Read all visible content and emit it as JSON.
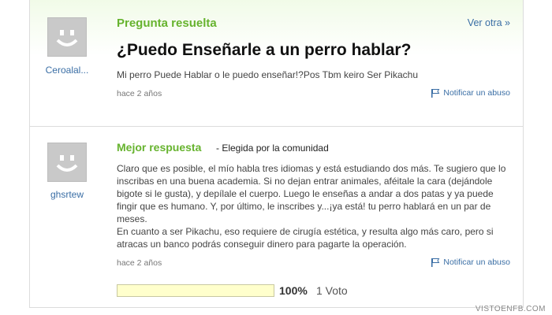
{
  "question": {
    "header": "Pregunta resuelta",
    "see_other": "Ver otra »",
    "asker": "Ceroalal...",
    "title": "¿Puedo Enseñarle a un perro hablar?",
    "detail": "Mi perro Puede Hablar o le puedo enseñar!?Pos Tbm keiro Ser Pikachu",
    "timestamp": "hace 2 años",
    "report": "Notificar un abuso"
  },
  "answer": {
    "header": "Mejor respuesta",
    "chosen_by": "- Elegida por la comunidad",
    "answerer": "ghsrtew",
    "paragraphs": [
      "Claro que es posible, el mío habla tres idiomas y está estudiando dos más. Te sugiero que lo inscribas en una buena academia. Si no dejan entrar animales, aféitale la cara (dejándole bigote si le gusta), y depílale el cuerpo. Luego le enseñas a andar a dos patas y ya puede fingir que es humano. Y, por último, le inscribes y...¡ya está! tu perro hablará en un par de meses.",
      "En cuanto a ser Pikachu, eso requiere de cirugía estética, y resulta algo más caro, pero si atracas un banco podrás conseguir dinero para pagarte la operación."
    ],
    "timestamp": "hace 2 años",
    "report": "Notificar un abuso"
  },
  "votes": {
    "percent_label": "100%",
    "percent_value": 100,
    "count_label": "1 Voto"
  },
  "watermark": "VISTOENFB.COM",
  "colors": {
    "accent_green": "#66b32e",
    "link_blue": "#3a6ea5",
    "vote_fill": "#ffffcc"
  },
  "icons": {
    "avatar": "default-smiley-avatar-icon",
    "report": "flag-icon"
  }
}
